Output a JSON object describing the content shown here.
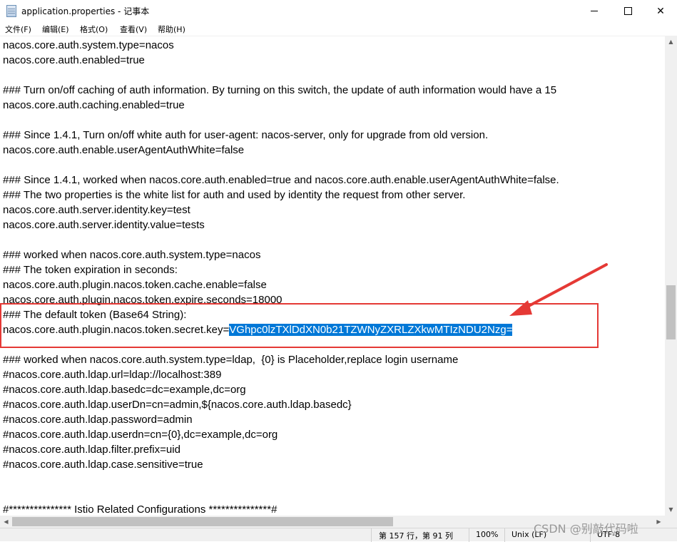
{
  "window": {
    "title": "application.properties - 记事本",
    "minimize_icon": "minimize-icon",
    "maximize_icon": "maximize-icon",
    "close_icon": "close-icon",
    "close_glyph": "✕"
  },
  "menu": {
    "items": [
      "文件(F)",
      "编辑(E)",
      "格式(O)",
      "查看(V)",
      "帮助(H)"
    ]
  },
  "editor": {
    "lines": [
      "nacos.core.auth.system.type=nacos",
      "nacos.core.auth.enabled=true",
      "",
      "### Turn on/off caching of auth information. By turning on this switch, the update of auth information would have a 15",
      "nacos.core.auth.caching.enabled=true",
      "",
      "### Since 1.4.1, Turn on/off white auth for user-agent: nacos-server, only for upgrade from old version.",
      "nacos.core.auth.enable.userAgentAuthWhite=false",
      "",
      "### Since 1.4.1, worked when nacos.core.auth.enabled=true and nacos.core.auth.enable.userAgentAuthWhite=false.",
      "### The two properties is the white list for auth and used by identity the request from other server.",
      "nacos.core.auth.server.identity.key=test",
      "nacos.core.auth.server.identity.value=tests",
      "",
      "### worked when nacos.core.auth.system.type=nacos",
      "### The token expiration in seconds:",
      "nacos.core.auth.plugin.nacos.token.cache.enable=false",
      "nacos.core.auth.plugin.nacos.token.expire.seconds=18000",
      "### The default token (Base64 String):",
      "",
      "",
      "### worked when nacos.core.auth.system.type=ldap,  {0} is Placeholder,replace login username",
      "#nacos.core.auth.ldap.url=ldap://localhost:389",
      "#nacos.core.auth.ldap.basedc=dc=example,dc=org",
      "#nacos.core.auth.ldap.userDn=cn=admin,${nacos.core.auth.ldap.basedc}",
      "#nacos.core.auth.ldap.password=admin",
      "#nacos.core.auth.ldap.userdn=cn={0},dc=example,dc=org",
      "#nacos.core.auth.ldap.filter.prefix=uid",
      "#nacos.core.auth.ldap.case.sensitive=true",
      "",
      "",
      "",
      "#*************** Istio Related Configurations ***************#"
    ],
    "secret_key_prefix": "nacos.core.auth.plugin.nacos.token.secret.key=",
    "secret_key_value": "VGhpc0lzTXlDdXN0b21TZWNyZXRLZXkwMTIzNDU2Nzg="
  },
  "status": {
    "position": "第 157 行，第 91 列",
    "zoom": "100%",
    "line_ending": "Unix (LF)",
    "encoding": "UTF-8"
  },
  "watermark": "CSDN @别敲代码啦",
  "colors": {
    "selection": "#0078d7",
    "annotation": "#e53935"
  }
}
